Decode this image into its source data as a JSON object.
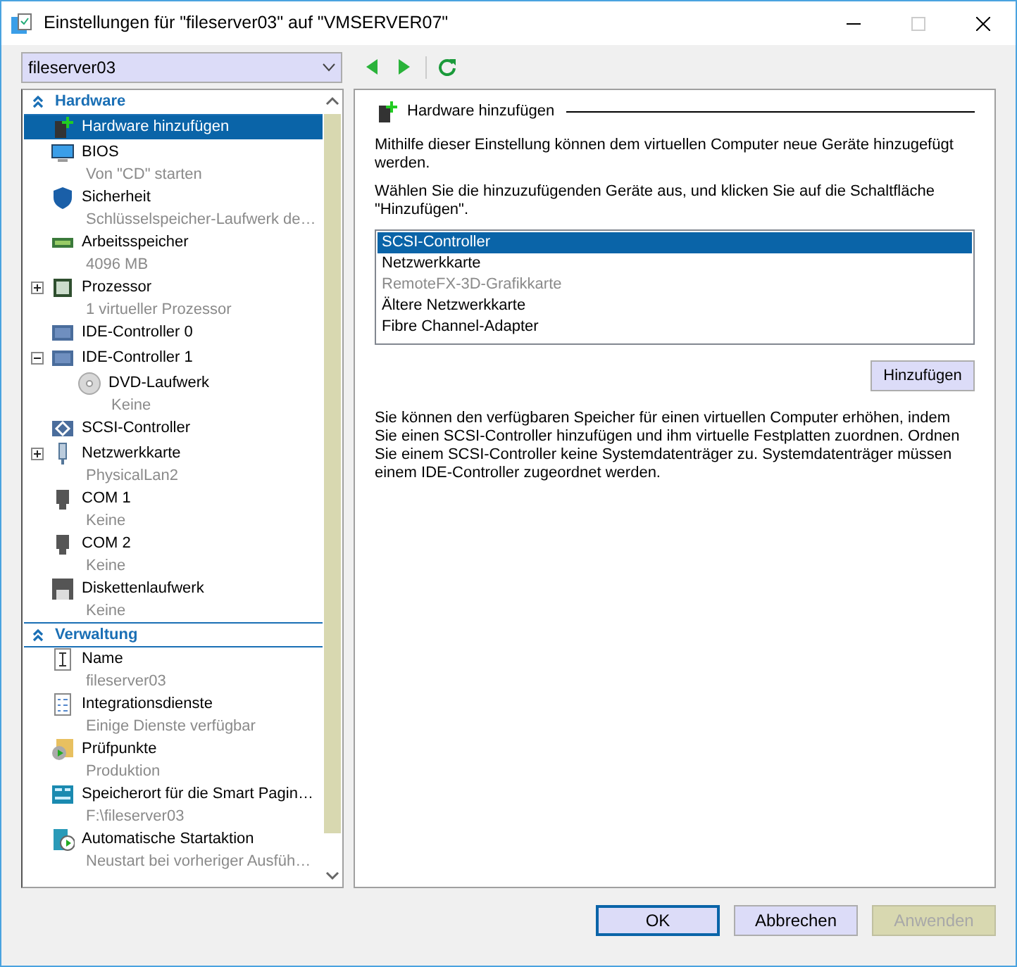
{
  "window": {
    "title": "Einstellungen für \"fileserver03\" auf \"VMSERVER07\""
  },
  "vm_selector": {
    "value": "fileserver03"
  },
  "sidebar": {
    "sections": [
      {
        "title": "Hardware",
        "expanded": true,
        "items": [
          {
            "kind": "add-hardware",
            "name": "Hardware hinzufügen",
            "selected": true
          },
          {
            "kind": "bios",
            "name": "BIOS",
            "sub": "Von \"CD\" starten",
            "selected": false
          },
          {
            "kind": "security",
            "name": "Sicherheit",
            "sub": "Schlüsselspeicher-Laufwerk de…",
            "selected": false
          },
          {
            "kind": "memory",
            "name": "Arbeitsspeicher",
            "sub": "4096 MB",
            "selected": false
          },
          {
            "kind": "cpu",
            "name": "Prozessor",
            "sub": "1 virtueller Prozessor",
            "selected": false,
            "expanded": false
          },
          {
            "kind": "controller",
            "name": "IDE-Controller 0",
            "selected": false
          },
          {
            "kind": "controller",
            "name": "IDE-Controller 1",
            "selected": false,
            "expanded": true,
            "children": [
              {
                "kind": "dvd",
                "name": "DVD-Laufwerk",
                "sub": "Keine",
                "selected": false
              }
            ]
          },
          {
            "kind": "scsi",
            "name": "SCSI-Controller",
            "selected": false
          },
          {
            "kind": "network",
            "name": "Netzwerkkarte",
            "sub": "PhysicalLan2",
            "selected": false,
            "expanded": false
          },
          {
            "kind": "port",
            "name": "COM 1",
            "sub": "Keine",
            "selected": false
          },
          {
            "kind": "port",
            "name": "COM 2",
            "sub": "Keine",
            "selected": false
          },
          {
            "kind": "floppy",
            "name": "Diskettenlaufwerk",
            "sub": "Keine",
            "selected": false
          }
        ]
      },
      {
        "title": "Verwaltung",
        "expanded": true,
        "items": [
          {
            "kind": "name",
            "name": "Name",
            "sub": "fileserver03",
            "selected": false
          },
          {
            "kind": "services",
            "name": "Integrationsdienste",
            "sub": "Einige Dienste verfügbar",
            "selected": false
          },
          {
            "kind": "checkpoint",
            "name": "Prüfpunkte",
            "sub": "Produktion",
            "selected": false
          },
          {
            "kind": "paging",
            "name": "Speicherort für die Smart Pagin…",
            "sub": "F:\\fileserver03",
            "selected": false
          },
          {
            "kind": "start",
            "name": "Automatische Startaktion",
            "sub": "Neustart bei vorheriger Ausfüh…",
            "selected": false
          }
        ]
      }
    ]
  },
  "panel": {
    "heading": "Hardware hinzufügen",
    "intro": "Mithilfe dieser Einstellung können dem virtuellen Computer neue Geräte hinzugefügt werden.",
    "instruction": "Wählen Sie die hinzuzufügenden Geräte aus, und klicken Sie auf die Schaltfläche \"Hinzufügen\".",
    "devices": [
      {
        "label": "SCSI-Controller",
        "selected": true,
        "disabled": false
      },
      {
        "label": "Netzwerkkarte",
        "selected": false,
        "disabled": false
      },
      {
        "label": "RemoteFX-3D-Grafikkarte",
        "selected": false,
        "disabled": true
      },
      {
        "label": "Ältere Netzwerkkarte",
        "selected": false,
        "disabled": false
      },
      {
        "label": "Fibre Channel-Adapter",
        "selected": false,
        "disabled": false
      }
    ],
    "add_button": "Hinzufügen",
    "note": "Sie können den verfügbaren Speicher für einen virtuellen Computer erhöhen, indem Sie einen SCSI-Controller hinzufügen und ihm virtuelle Festplatten zuordnen. Ordnen Sie einem SCSI-Controller keine Systemdatenträger zu. Systemdatenträger müssen einem IDE-Controller zugeordnet werden."
  },
  "buttons": [
    {
      "label": "OK",
      "default": true,
      "disabled": false
    },
    {
      "label": "Abbrechen",
      "default": false,
      "disabled": false
    },
    {
      "label": "Anwenden",
      "default": false,
      "disabled": true
    }
  ]
}
